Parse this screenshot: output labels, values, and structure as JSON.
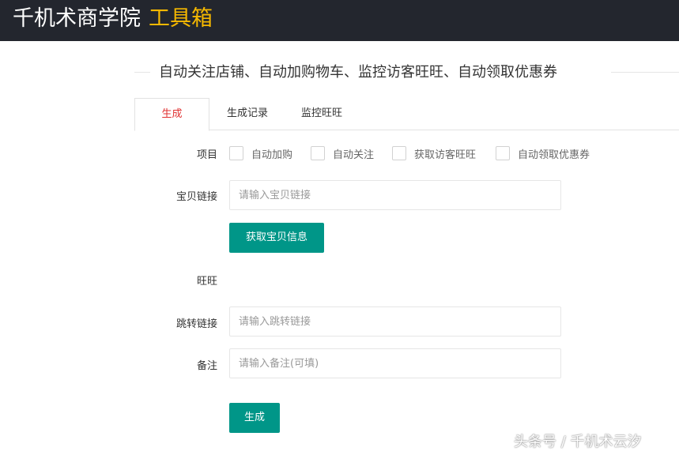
{
  "header": {
    "brand_main": "千机术商学院",
    "brand_accent": "工具箱"
  },
  "section": {
    "title": "自动关注店铺、自动加购物车、监控访客旺旺、自动领取优惠券"
  },
  "tabs": [
    {
      "label": "生成",
      "active": true
    },
    {
      "label": "生成记录",
      "active": false
    },
    {
      "label": "监控旺旺",
      "active": false
    }
  ],
  "form": {
    "project_label": "项目",
    "options": [
      {
        "label": "自动加购",
        "checked": false
      },
      {
        "label": "自动关注",
        "checked": false
      },
      {
        "label": "获取访客旺旺",
        "checked": false
      },
      {
        "label": "自动领取优惠券",
        "checked": false
      }
    ],
    "item_link_label": "宝贝链接",
    "item_link_placeholder": "请输入宝贝链接",
    "fetch_button": "获取宝贝信息",
    "wangwang_label": "旺旺",
    "jump_link_label": "跳转链接",
    "jump_link_placeholder": "请输入跳转链接",
    "note_label": "备注",
    "note_placeholder": "请输入备注(可填)",
    "submit_button": "生成"
  },
  "watermark": "头条号 / 千机术云汐",
  "colors": {
    "topbar": "#23262e",
    "brand_accent": "#f5b800",
    "active_tab": "#e03131",
    "primary_button": "#009688"
  }
}
